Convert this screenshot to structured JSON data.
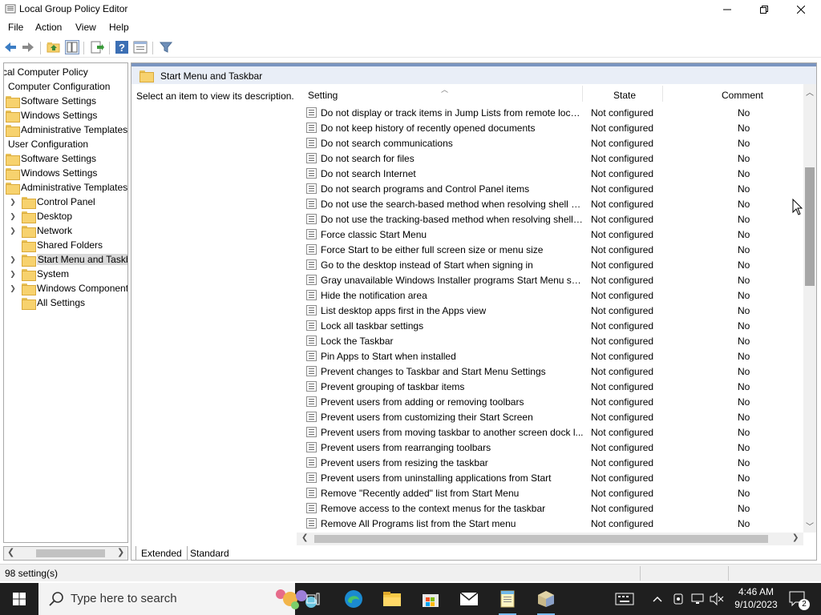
{
  "window": {
    "title": "Local Group Policy Editor",
    "controls": [
      "minimize",
      "maximize",
      "close"
    ]
  },
  "menubar": [
    "File",
    "Action",
    "View",
    "Help"
  ],
  "toolbar": {
    "icons": [
      "back-arrow-icon",
      "forward-arrow-icon",
      "up-folder-icon",
      "show-hide-tree-icon",
      "export-list-icon",
      "help-icon",
      "properties-icon",
      "filter-icon"
    ]
  },
  "tree": {
    "items": [
      {
        "label": "Local Computer Policy",
        "shown": "cal Computer Policy",
        "level": 0
      },
      {
        "label": "Computer Configuration",
        "level": 0
      },
      {
        "label": "Software Settings",
        "level": 1
      },
      {
        "label": "Windows Settings",
        "level": 1
      },
      {
        "label": "Administrative Templates",
        "level": 1
      },
      {
        "label": "User Configuration",
        "level": 0
      },
      {
        "label": "Software Settings",
        "level": 1
      },
      {
        "label": "Windows Settings",
        "level": 1
      },
      {
        "label": "Administrative Templates",
        "level": 1
      },
      {
        "label": "Control Panel",
        "level": 2,
        "expander": true
      },
      {
        "label": "Desktop",
        "level": 2,
        "expander": true
      },
      {
        "label": "Network",
        "level": 2,
        "expander": true
      },
      {
        "label": "Shared Folders",
        "level": 2,
        "expander": false
      },
      {
        "label": "Start Menu and Taskbar",
        "level": 2,
        "expander": true,
        "selected": true
      },
      {
        "label": "System",
        "level": 2,
        "expander": true
      },
      {
        "label": "Windows Components",
        "level": 2,
        "expander": true
      },
      {
        "label": "All Settings",
        "level": 2,
        "expander": false,
        "special": true
      }
    ]
  },
  "detail": {
    "header": "Start Menu and Taskbar",
    "description": "Select an item to view its description."
  },
  "columns": {
    "setting": "Setting",
    "state": "State",
    "comment": "Comment"
  },
  "rows": [
    {
      "setting": "Do not display or track items in Jump Lists from remote loca...",
      "state": "Not configured",
      "comment": "No"
    },
    {
      "setting": "Do not keep history of recently opened documents",
      "state": "Not configured",
      "comment": "No"
    },
    {
      "setting": "Do not search communications",
      "state": "Not configured",
      "comment": "No"
    },
    {
      "setting": "Do not search for files",
      "state": "Not configured",
      "comment": "No"
    },
    {
      "setting": "Do not search Internet",
      "state": "Not configured",
      "comment": "No"
    },
    {
      "setting": "Do not search programs and Control Panel items",
      "state": "Not configured",
      "comment": "No"
    },
    {
      "setting": "Do not use the search-based method when resolving shell s...",
      "state": "Not configured",
      "comment": "No"
    },
    {
      "setting": "Do not use the tracking-based method when resolving shell ...",
      "state": "Not configured",
      "comment": "No"
    },
    {
      "setting": "Force classic Start Menu",
      "state": "Not configured",
      "comment": "No"
    },
    {
      "setting": "Force Start to be either full screen size or menu size",
      "state": "Not configured",
      "comment": "No"
    },
    {
      "setting": "Go to the desktop instead of Start when signing in",
      "state": "Not configured",
      "comment": "No"
    },
    {
      "setting": "Gray unavailable Windows Installer programs Start Menu sh...",
      "state": "Not configured",
      "comment": "No"
    },
    {
      "setting": "Hide the notification area",
      "state": "Not configured",
      "comment": "No"
    },
    {
      "setting": "List desktop apps first in the Apps view",
      "state": "Not configured",
      "comment": "No"
    },
    {
      "setting": "Lock all taskbar settings",
      "state": "Not configured",
      "comment": "No"
    },
    {
      "setting": "Lock the Taskbar",
      "state": "Not configured",
      "comment": "No"
    },
    {
      "setting": "Pin Apps to Start when installed",
      "state": "Not configured",
      "comment": "No"
    },
    {
      "setting": "Prevent changes to Taskbar and Start Menu Settings",
      "state": "Not configured",
      "comment": "No"
    },
    {
      "setting": "Prevent grouping of taskbar items",
      "state": "Not configured",
      "comment": "No"
    },
    {
      "setting": "Prevent users from adding or removing toolbars",
      "state": "Not configured",
      "comment": "No"
    },
    {
      "setting": "Prevent users from customizing their Start Screen",
      "state": "Not configured",
      "comment": "No"
    },
    {
      "setting": "Prevent users from moving taskbar to another screen dock l...",
      "state": "Not configured",
      "comment": "No"
    },
    {
      "setting": "Prevent users from rearranging toolbars",
      "state": "Not configured",
      "comment": "No"
    },
    {
      "setting": "Prevent users from resizing the taskbar",
      "state": "Not configured",
      "comment": "No"
    },
    {
      "setting": "Prevent users from uninstalling applications from Start",
      "state": "Not configured",
      "comment": "No"
    },
    {
      "setting": "Remove \"Recently added\" list from Start Menu",
      "state": "Not configured",
      "comment": "No"
    },
    {
      "setting": "Remove access to the context menus for the taskbar",
      "state": "Not configured",
      "comment": "No"
    },
    {
      "setting": "Remove All Programs list from the Start menu",
      "state": "Not configured",
      "comment": "No"
    }
  ],
  "tabs": [
    "Extended",
    "Standard"
  ],
  "active_tab": "Extended",
  "status": "98 setting(s)",
  "taskbar": {
    "search_placeholder": "Type here to search",
    "time": "4:46 AM",
    "date": "9/10/2023",
    "notification_count": "2",
    "pinned": [
      "task-view-icon",
      "edge-icon",
      "file-explorer-icon",
      "store-icon",
      "mail-icon",
      "notepad-icon",
      "package-icon"
    ]
  },
  "colors": {
    "header_band": "#e9eef7",
    "header_border": "#7a95c0",
    "taskbar": "#1f1f1f",
    "selection": "#d9d9d9"
  }
}
